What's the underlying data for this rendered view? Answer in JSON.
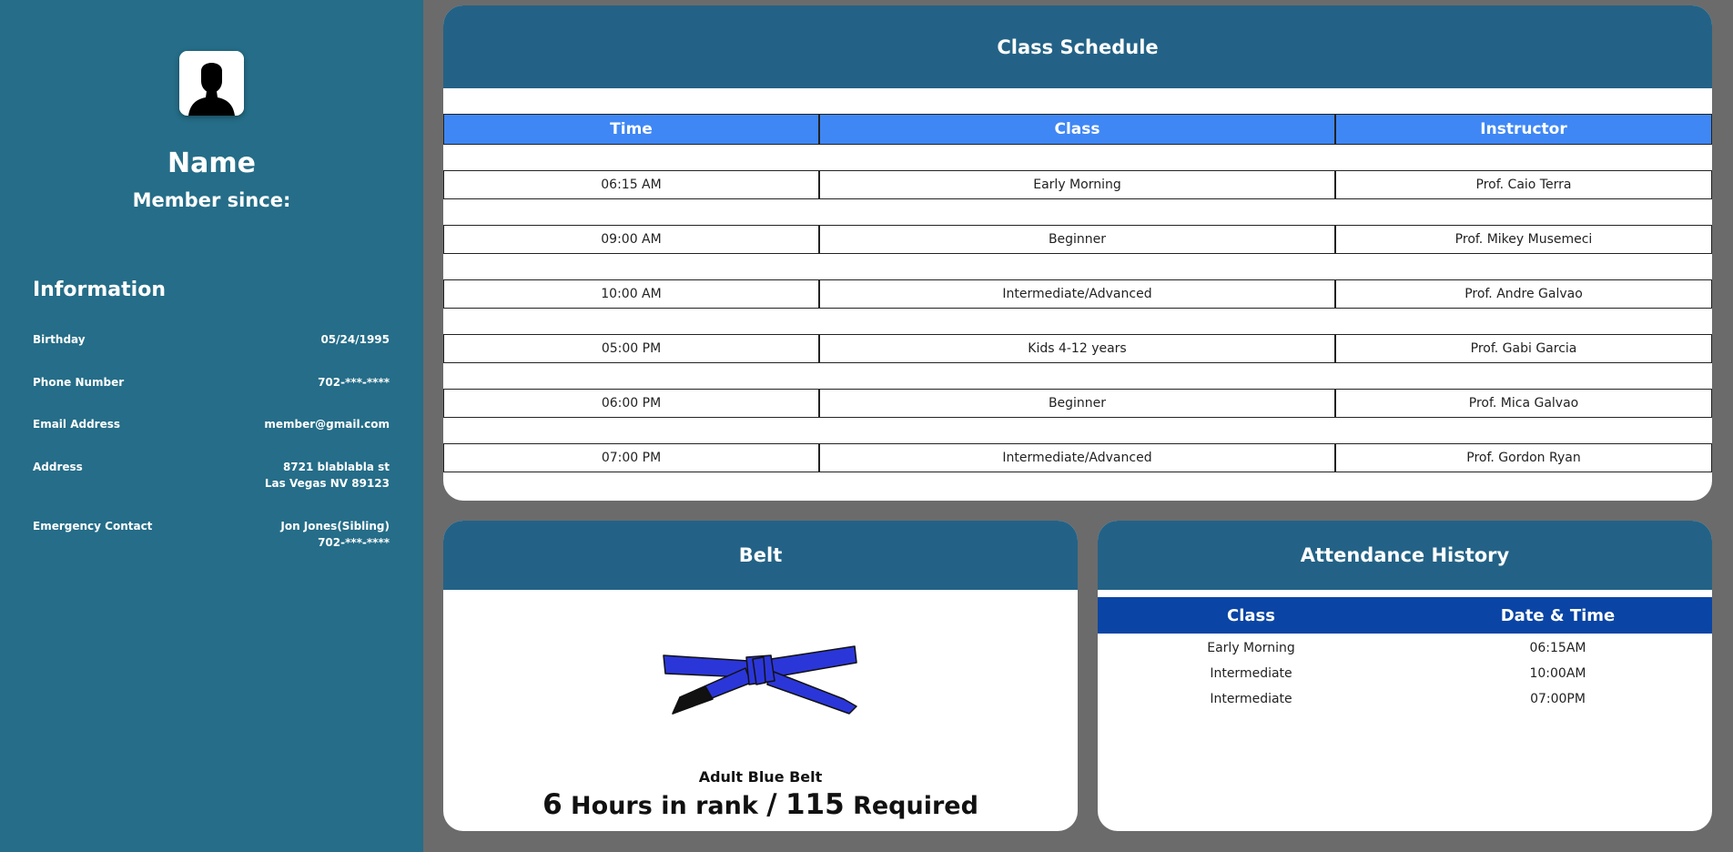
{
  "profile": {
    "name": "Name",
    "member_since_label": "Member since:",
    "avatar_icon": "user-silhouette-icon"
  },
  "info": {
    "heading": "Information",
    "birthday_label": "Birthday",
    "birthday_value": "05/24/1995",
    "phone_label": "Phone Number",
    "phone_value": "702-***-****",
    "email_label": "Email Address",
    "email_value": "member@gmail.com",
    "address_label": "Address",
    "address_line1": "8721 blablabla st",
    "address_line2": "Las Vegas NV 89123",
    "emergency_label": "Emergency Contact",
    "emergency_name": "Jon Jones(Sibling)",
    "emergency_phone": "702-***-****"
  },
  "schedule": {
    "title": "Class Schedule",
    "columns": [
      "Time",
      "Class",
      "Instructor"
    ],
    "rows": [
      [
        "06:15 AM",
        "Early Morning",
        "Prof. Caio Terra"
      ],
      [
        "09:00 AM",
        "Beginner",
        "Prof. Mikey Musemeci"
      ],
      [
        "10:00 AM",
        "Intermediate/Advanced",
        "Prof. Andre Galvao"
      ],
      [
        "05:00 PM",
        "Kids 4-12 years",
        "Prof. Gabi Garcia"
      ],
      [
        "06:00 PM",
        "Beginner",
        "Prof. Mica Galvao"
      ],
      [
        "07:00 PM",
        "Intermediate/Advanced",
        "Prof. Gordon Ryan"
      ]
    ]
  },
  "belt": {
    "title": "Belt",
    "rank": "Adult Blue Belt",
    "hours_in_rank": "6",
    "hours_label": "Hours in rank",
    "separator": "/",
    "required_hours": "115",
    "required_label": "Required",
    "belt_color": "#2b36d9",
    "belt_icon": "bjj-belt-icon"
  },
  "attendance": {
    "title": "Attendance History",
    "columns": [
      "Class",
      "Date & Time"
    ],
    "rows": [
      [
        "Early Morning",
        "06:15AM"
      ],
      [
        "Intermediate",
        "10:00AM"
      ],
      [
        "Intermediate",
        "07:00PM"
      ]
    ]
  },
  "colors": {
    "sidebar": "#256d88",
    "card_header": "#236286",
    "schedule_header": "#3f87f5",
    "attendance_header": "#0a45a5",
    "page_background": "#6b6b6b"
  }
}
